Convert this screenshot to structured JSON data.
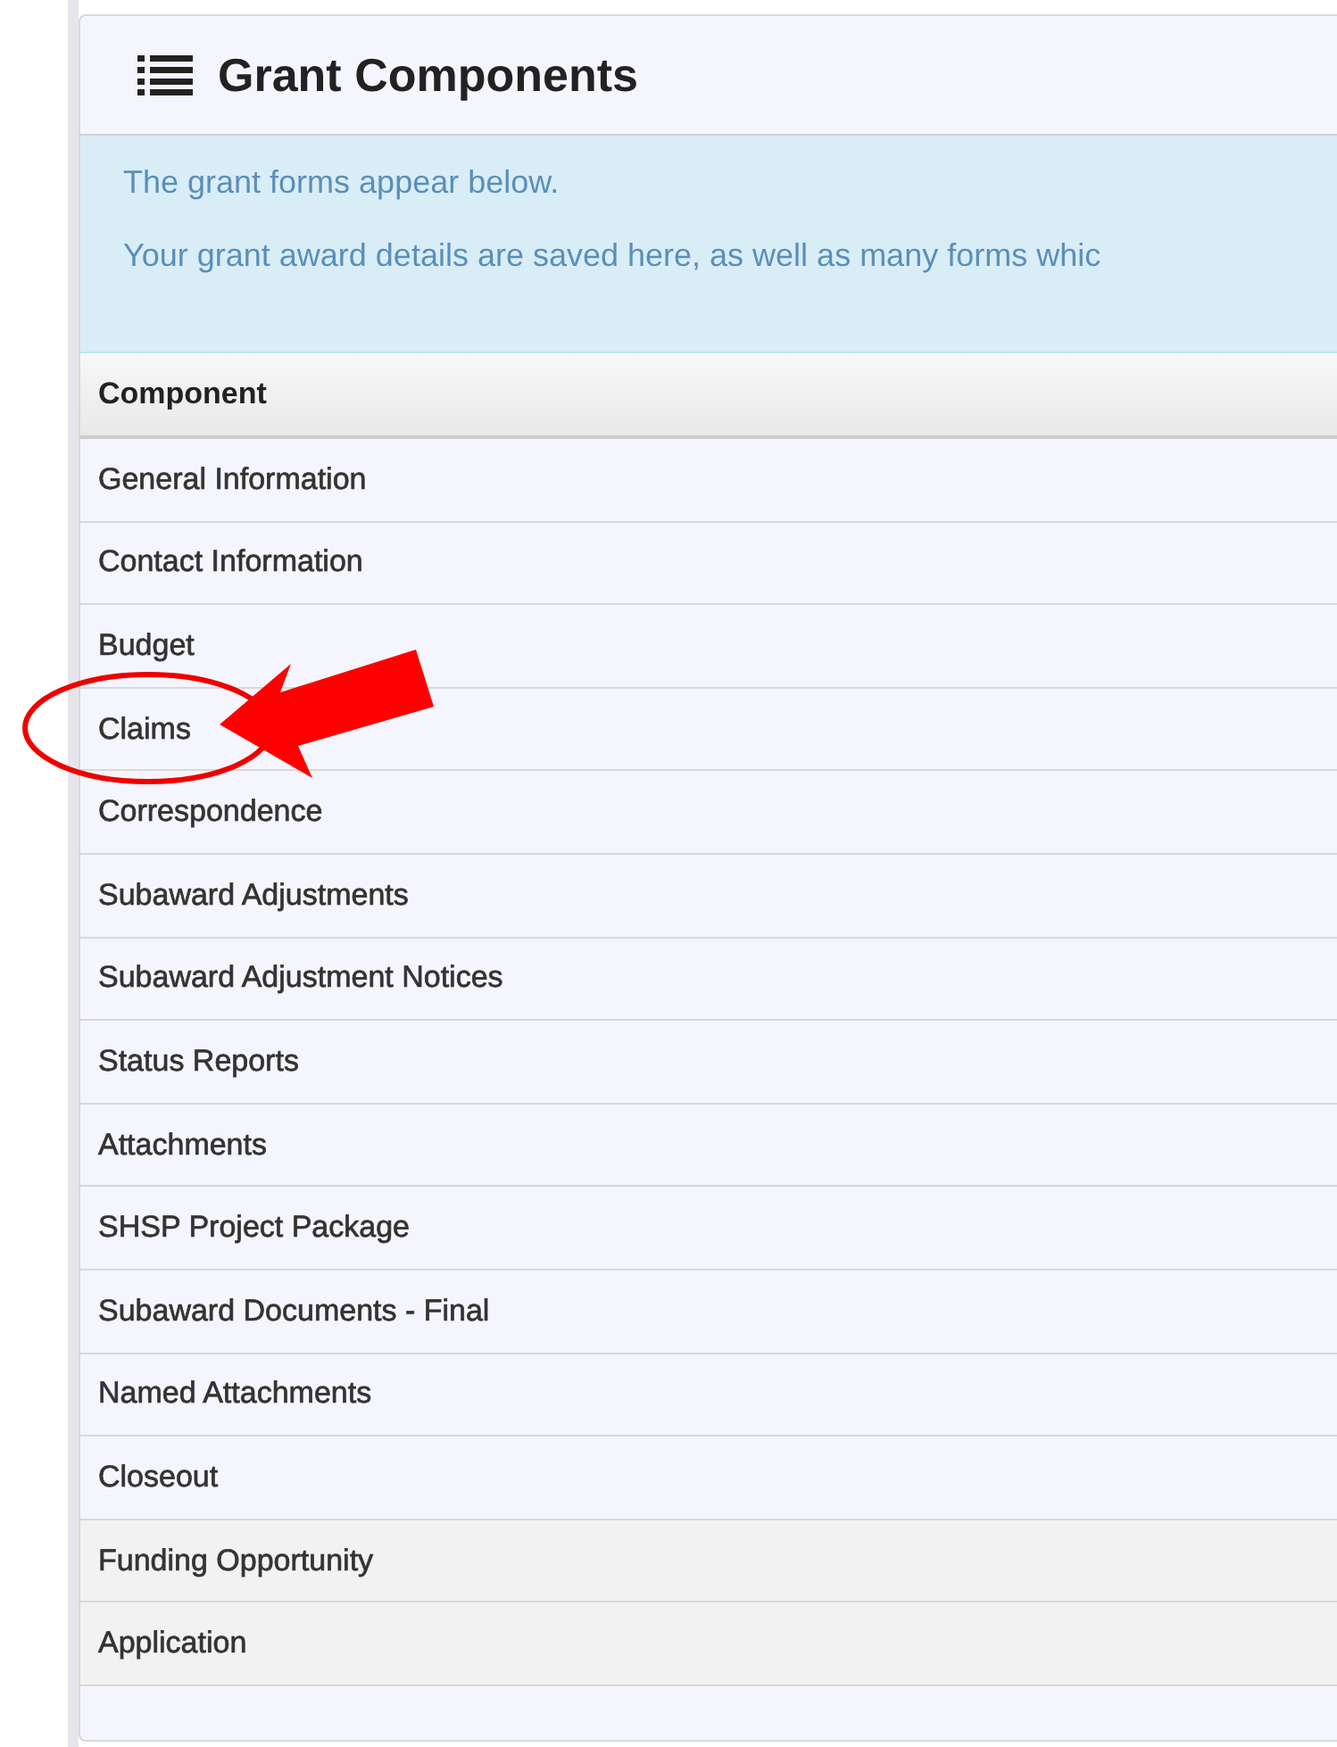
{
  "panel": {
    "title": "Grant Components"
  },
  "info": [
    "The grant forms appear below.",
    "Your grant award details are saved here, as well as many forms whic"
  ],
  "table": {
    "columns": [
      "Component"
    ],
    "rows": [
      {
        "label": "General Information",
        "shaded": false,
        "highlighted": false
      },
      {
        "label": "Contact Information",
        "shaded": false,
        "highlighted": false
      },
      {
        "label": "Budget",
        "shaded": false,
        "highlighted": false
      },
      {
        "label": "Claims",
        "shaded": false,
        "highlighted": true
      },
      {
        "label": "Correspondence",
        "shaded": false,
        "highlighted": false
      },
      {
        "label": "Subaward Adjustments",
        "shaded": false,
        "highlighted": false
      },
      {
        "label": "Subaward Adjustment Notices",
        "shaded": false,
        "highlighted": false
      },
      {
        "label": "Status Reports",
        "shaded": false,
        "highlighted": false
      },
      {
        "label": "Attachments",
        "shaded": false,
        "highlighted": false
      },
      {
        "label": "SHSP Project Package",
        "shaded": false,
        "highlighted": false
      },
      {
        "label": "Subaward Documents - Final",
        "shaded": false,
        "highlighted": false
      },
      {
        "label": "Named Attachments",
        "shaded": false,
        "highlighted": false
      },
      {
        "label": "Closeout",
        "shaded": false,
        "highlighted": false
      },
      {
        "label": "Funding Opportunity",
        "shaded": true,
        "highlighted": false
      },
      {
        "label": "Application",
        "shaded": true,
        "highlighted": false
      }
    ]
  }
}
